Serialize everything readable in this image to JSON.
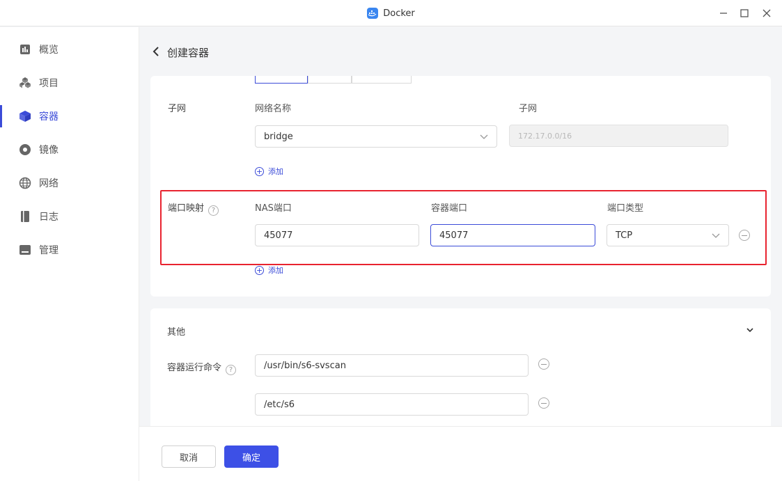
{
  "window": {
    "title": "Docker"
  },
  "sidebar": {
    "items": [
      {
        "label": "概览",
        "icon": "overview-icon"
      },
      {
        "label": "项目",
        "icon": "project-icon"
      },
      {
        "label": "容器",
        "icon": "container-icon",
        "active": true
      },
      {
        "label": "镜像",
        "icon": "image-icon"
      },
      {
        "label": "网络",
        "icon": "globe-icon"
      },
      {
        "label": "日志",
        "icon": "log-icon"
      },
      {
        "label": "管理",
        "icon": "manage-icon"
      }
    ]
  },
  "page": {
    "title": "创建容器"
  },
  "subnet": {
    "label": "子网",
    "network_name_label": "网络名称",
    "subnet_label": "子网",
    "network_value": "bridge",
    "subnet_value": "172.17.0.0/16",
    "add_label": "添加"
  },
  "ports": {
    "label": "端口映射",
    "nas_port_label": "NAS端口",
    "container_port_label": "容器端口",
    "port_type_label": "端口类型",
    "nas_port_value": "45077",
    "container_port_value": "45077",
    "port_type_value": "TCP",
    "add_label": "添加"
  },
  "other": {
    "title": "其他",
    "command_label": "容器运行命令",
    "commands": [
      "/usr/bin/s6-svscan",
      "/etc/s6"
    ]
  },
  "footer": {
    "cancel_label": "取消",
    "ok_label": "确定"
  },
  "colors": {
    "accent": "#3b4bd8",
    "highlight": "#e8232f"
  }
}
